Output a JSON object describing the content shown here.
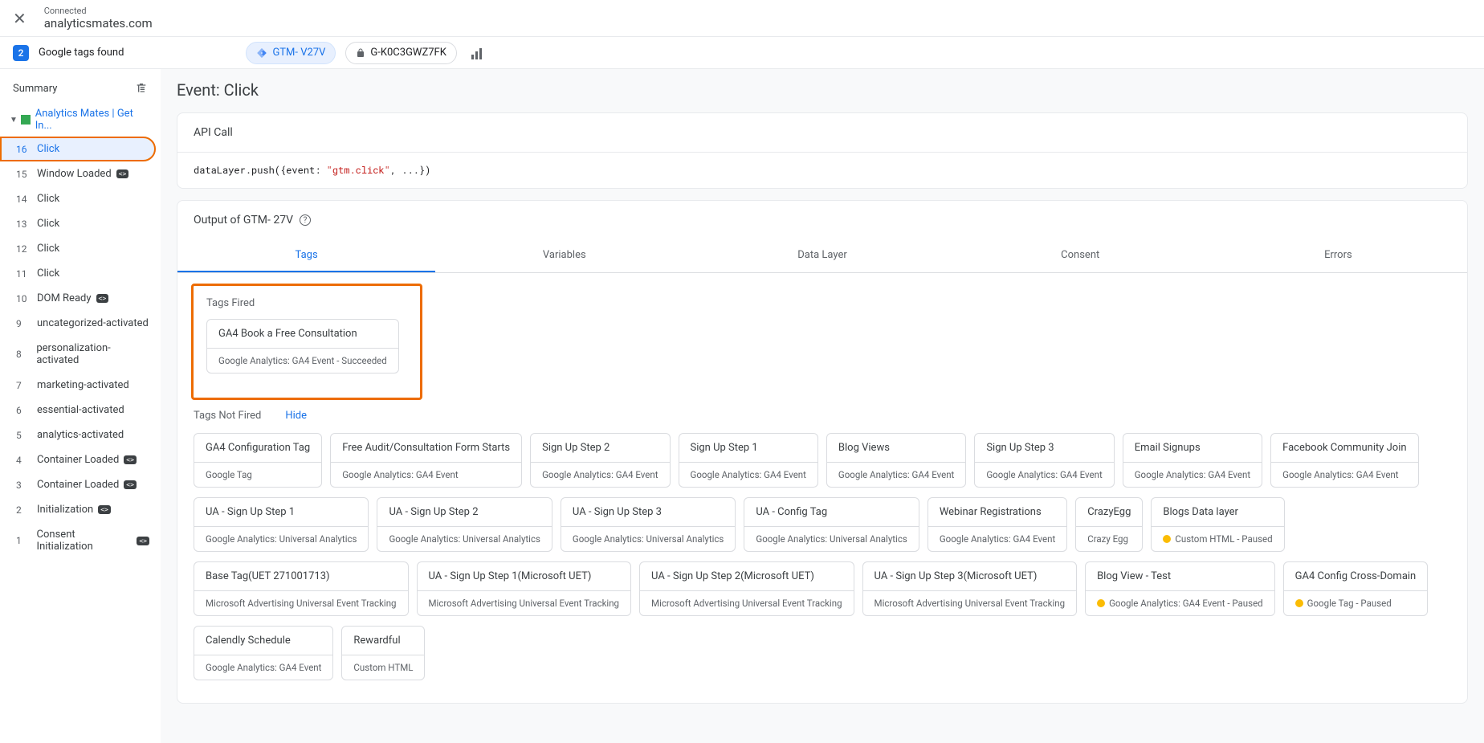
{
  "header": {
    "connected_label": "Connected",
    "domain": "analyticsmates.com",
    "count": "2",
    "found_label": "Google tags found",
    "pill1": "GTM-       V27V",
    "pill2": "G-K0C3GWZ7FK"
  },
  "sidebar": {
    "summary": "Summary",
    "tree_label": "Analytics Mates | Get In...",
    "events": [
      {
        "num": "16",
        "name": "Click",
        "active": true,
        "highlighted": true
      },
      {
        "num": "15",
        "name": "Window Loaded",
        "code_icon": true
      },
      {
        "num": "14",
        "name": "Click"
      },
      {
        "num": "13",
        "name": "Click"
      },
      {
        "num": "12",
        "name": "Click"
      },
      {
        "num": "11",
        "name": "Click"
      },
      {
        "num": "10",
        "name": "DOM Ready",
        "code_icon": true
      },
      {
        "num": "9",
        "name": "uncategorized-activated"
      },
      {
        "num": "8",
        "name": "personalization-activated"
      },
      {
        "num": "7",
        "name": "marketing-activated"
      },
      {
        "num": "6",
        "name": "essential-activated"
      },
      {
        "num": "5",
        "name": "analytics-activated"
      },
      {
        "num": "4",
        "name": "Container Loaded",
        "code_icon": true
      },
      {
        "num": "3",
        "name": "Container Loaded",
        "code_icon": true
      },
      {
        "num": "2",
        "name": "Initialization",
        "code_icon": true
      },
      {
        "num": "1",
        "name": "Consent Initialization",
        "code_icon": true
      }
    ]
  },
  "content": {
    "title": "Event: Click",
    "api_call": "API Call",
    "code_prefix": "dataLayer.push({event: ",
    "code_string": "\"gtm.click\"",
    "code_suffix": ", ...})",
    "output_label": "Output of GTM-       27V",
    "tabs": [
      "Tags",
      "Variables",
      "Data Layer",
      "Consent",
      "Errors"
    ],
    "fired_label": "Tags Fired",
    "fired_tags": [
      {
        "title": "GA4 Book a Free Consultation",
        "sub": "Google Analytics: GA4 Event - Succeeded"
      }
    ],
    "notfired_label": "Tags Not Fired",
    "hide": "Hide",
    "notfired_tags": [
      {
        "title": "GA4 Configuration Tag",
        "sub": "Google Tag"
      },
      {
        "title": "Free Audit/Consultation Form Starts",
        "sub": "Google Analytics: GA4 Event"
      },
      {
        "title": "Sign Up Step 2",
        "sub": "Google Analytics: GA4 Event"
      },
      {
        "title": "Sign Up Step 1",
        "sub": "Google Analytics: GA4 Event"
      },
      {
        "title": "Blog Views",
        "sub": "Google Analytics: GA4 Event"
      },
      {
        "title": "Sign Up Step 3",
        "sub": "Google Analytics: GA4 Event"
      },
      {
        "title": "Email Signups",
        "sub": "Google Analytics: GA4 Event"
      },
      {
        "title": "Facebook Community Join",
        "sub": "Google Analytics: GA4 Event"
      },
      {
        "title": "UA - Sign Up Step 1",
        "sub": "Google Analytics: Universal Analytics"
      },
      {
        "title": "UA - Sign Up Step 2",
        "sub": "Google Analytics: Universal Analytics"
      },
      {
        "title": "UA - Sign Up Step 3",
        "sub": "Google Analytics: Universal Analytics"
      },
      {
        "title": "UA - Config Tag",
        "sub": "Google Analytics: Universal Analytics"
      },
      {
        "title": "Webinar Registrations",
        "sub": "Google Analytics: GA4 Event"
      },
      {
        "title": "CrazyEgg",
        "sub": "Crazy Egg"
      },
      {
        "title": "Blogs Data layer",
        "sub": "Custom HTML - Paused",
        "paused": true
      },
      {
        "title": "Base Tag(UET 271001713)",
        "sub": "Microsoft Advertising Universal Event Tracking"
      },
      {
        "title": "UA - Sign Up Step 1(Microsoft UET)",
        "sub": "Microsoft Advertising Universal Event Tracking"
      },
      {
        "title": "UA - Sign Up Step 2(Microsoft UET)",
        "sub": "Microsoft Advertising Universal Event Tracking"
      },
      {
        "title": "UA - Sign Up Step 3(Microsoft UET)",
        "sub": "Microsoft Advertising Universal Event Tracking"
      },
      {
        "title": "Blog View - Test",
        "sub": "Google Analytics: GA4 Event - Paused",
        "paused": true
      },
      {
        "title": "GA4 Config Cross-Domain",
        "sub": "Google Tag - Paused",
        "paused": true
      },
      {
        "title": "Calendly Schedule",
        "sub": "Google Analytics: GA4 Event"
      },
      {
        "title": "Rewardful",
        "sub": "Custom HTML"
      }
    ]
  }
}
